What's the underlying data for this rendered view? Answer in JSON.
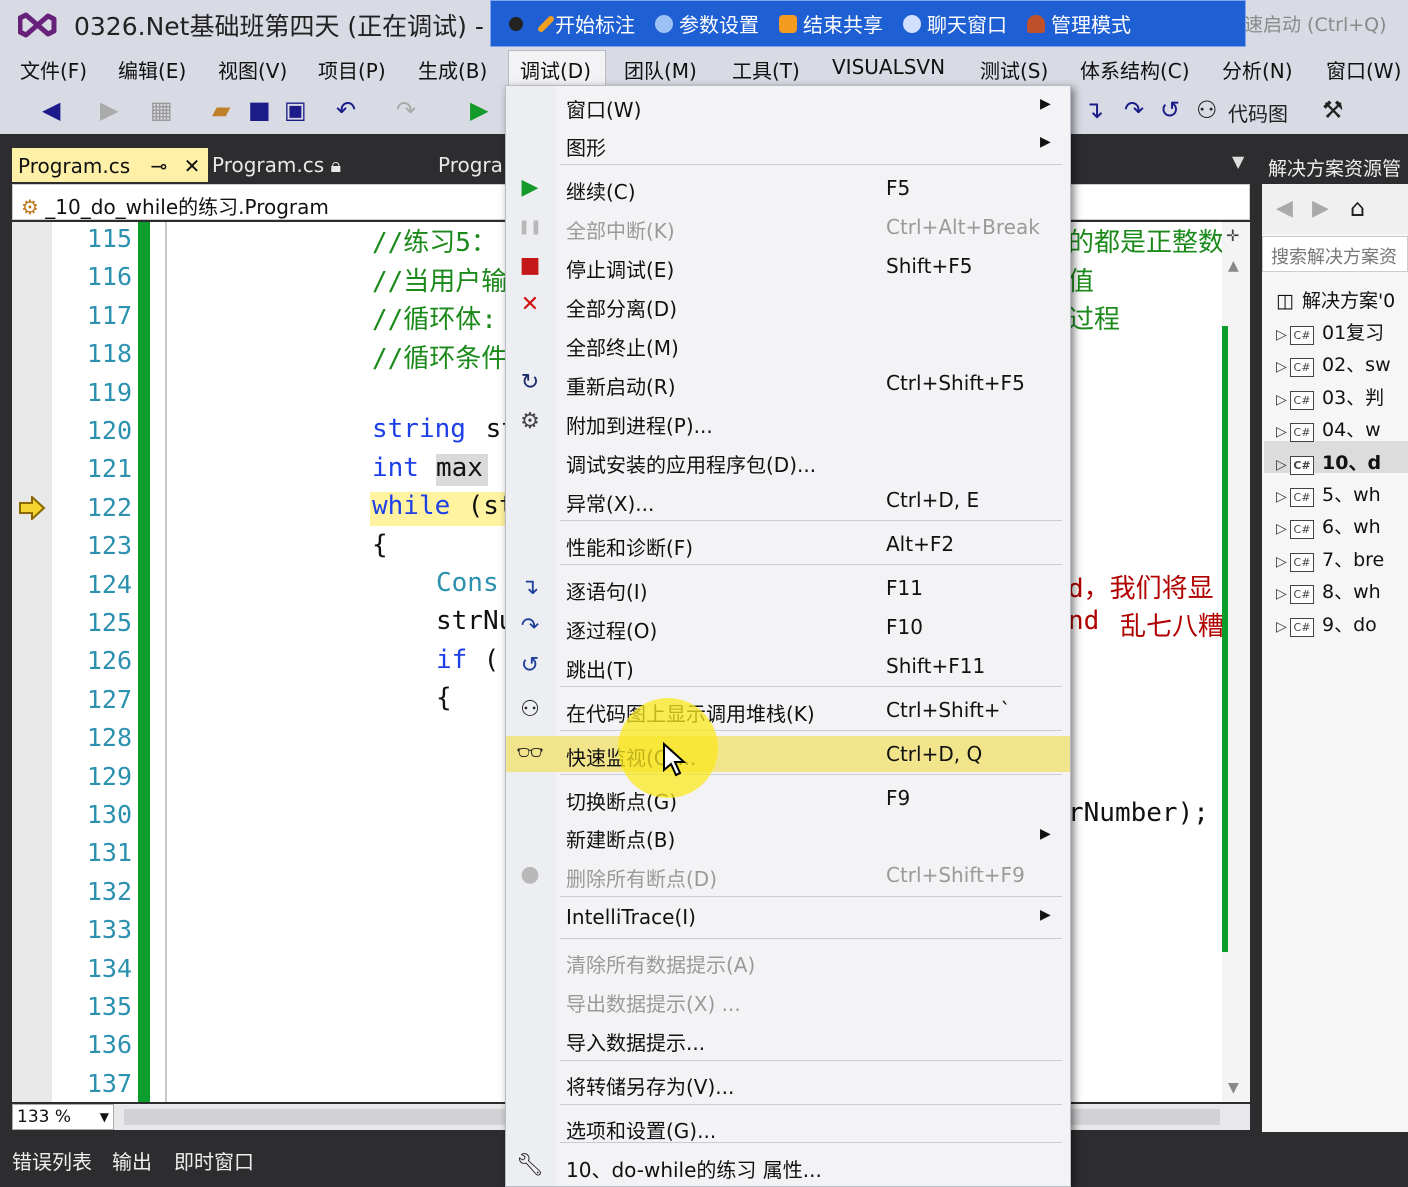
{
  "window": {
    "title": "0326.Net基础班第四天 (正在调试) -",
    "quick_launch_placeholder": "速启动 (Ctrl+Q)"
  },
  "capture_bar": {
    "items": [
      "开始标注",
      "参数设置",
      "结束共享",
      "聊天窗口",
      "管理模式"
    ]
  },
  "menubar": {
    "items": [
      "文件(F)",
      "编辑(E)",
      "视图(V)",
      "项目(P)",
      "生成(B)",
      "调试(D)",
      "团队(M)",
      "工具(T)",
      "VISUALSVN",
      "测试(S)",
      "体系结构(C)",
      "分析(N)",
      "窗口(W)"
    ]
  },
  "toolbar": {
    "codemap_label": "代码图"
  },
  "tabs": {
    "active": "Program.cs",
    "second": "Program.cs",
    "third": "Progra"
  },
  "navbar": {
    "path": "_10_do_while的练习.Program"
  },
  "editor": {
    "line_numbers": [
      "115",
      "116",
      "117",
      "118",
      "119",
      "120",
      "121",
      "122",
      "123",
      "124",
      "125",
      "126",
      "127",
      "128",
      "129",
      "130",
      "131",
      "132",
      "133",
      "134",
      "135",
      "136",
      "137"
    ],
    "code": {
      "l115": "//练习5：",
      "l115r": "的都是正整数",
      "l116": "//当用户输",
      "l116r": "值",
      "l117": "//循环体:",
      "l117r": "过程",
      "l118": "//循环条件",
      "l120_kw": "string",
      "l120_tx": " st",
      "l121_kw": "int",
      "l121_tx": "max",
      "l122_kw": "while",
      "l122_tx": " (st",
      "l123": "{",
      "l124": "Cons",
      "l124r": "d，我们将显",
      "l125": "strNu",
      "l125r_a": "nd",
      "l125r_b": "乱七八糟",
      "l126_kw": "if",
      "l126_tx": " (",
      "l127": "{",
      "l130r": "rNumber);"
    },
    "zoom": "133 %"
  },
  "bottom_tabs": [
    "错误列表",
    "输出",
    "即时窗口"
  ],
  "solution_explorer": {
    "header": "解决方案资源管",
    "search_placeholder": "搜索解决方案资",
    "root": "解决方案'0",
    "items": [
      "01复习",
      "02、sw",
      "03、判",
      "04、w",
      "10、d",
      "5、wh",
      "6、wh",
      "7、bre",
      "8、wh",
      "9、do"
    ],
    "selected_index": 4
  },
  "debug_menu": {
    "items": [
      {
        "label": "窗口(W)",
        "shortcut": "",
        "submenu": true,
        "disabled": false,
        "icon": ""
      },
      {
        "label": "图形",
        "shortcut": "",
        "submenu": true,
        "disabled": false,
        "icon": ""
      },
      {
        "label": "继续(C)",
        "shortcut": "F5",
        "submenu": false,
        "disabled": false,
        "icon": "play-icon"
      },
      {
        "label": "全部中断(K)",
        "shortcut": "Ctrl+Alt+Break",
        "submenu": false,
        "disabled": true,
        "icon": "pause-icon"
      },
      {
        "label": "停止调试(E)",
        "shortcut": "Shift+F5",
        "submenu": false,
        "disabled": false,
        "icon": "stop-icon"
      },
      {
        "label": "全部分离(D)",
        "shortcut": "",
        "submenu": false,
        "disabled": false,
        "icon": "detach-icon"
      },
      {
        "label": "全部终止(M)",
        "shortcut": "",
        "submenu": false,
        "disabled": false,
        "icon": ""
      },
      {
        "label": "重新启动(R)",
        "shortcut": "Ctrl+Shift+F5",
        "submenu": false,
        "disabled": false,
        "icon": "restart-icon"
      },
      {
        "label": "附加到进程(P)...",
        "shortcut": "",
        "submenu": false,
        "disabled": false,
        "icon": "attach-icon"
      },
      {
        "label": "调试安装的应用程序包(D)...",
        "shortcut": "",
        "submenu": false,
        "disabled": false,
        "icon": ""
      },
      {
        "label": "异常(X)...",
        "shortcut": "Ctrl+D, E",
        "submenu": false,
        "disabled": false,
        "icon": ""
      },
      {
        "label": "性能和诊断(F)",
        "shortcut": "Alt+F2",
        "submenu": false,
        "disabled": false,
        "icon": ""
      },
      {
        "label": "逐语句(I)",
        "shortcut": "F11",
        "submenu": false,
        "disabled": false,
        "icon": "step-into-icon"
      },
      {
        "label": "逐过程(O)",
        "shortcut": "F10",
        "submenu": false,
        "disabled": false,
        "icon": "step-over-icon"
      },
      {
        "label": "跳出(T)",
        "shortcut": "Shift+F11",
        "submenu": false,
        "disabled": false,
        "icon": "step-out-icon"
      },
      {
        "label": "在代码图上显示调用堆栈(K)",
        "shortcut": "Ctrl+Shift+`",
        "submenu": false,
        "disabled": false,
        "icon": "code-map-icon"
      },
      {
        "label": "快速监视(Q)...",
        "shortcut": "Ctrl+D, Q",
        "submenu": false,
        "disabled": false,
        "icon": "glasses-icon",
        "highlighted": true
      },
      {
        "label": "切换断点(G)",
        "shortcut": "F9",
        "submenu": false,
        "disabled": false,
        "icon": ""
      },
      {
        "label": "新建断点(B)",
        "shortcut": "",
        "submenu": true,
        "disabled": false,
        "icon": ""
      },
      {
        "label": "删除所有断点(D)",
        "shortcut": "Ctrl+Shift+F9",
        "submenu": false,
        "disabled": true,
        "icon": "delete-breakpoints-icon"
      },
      {
        "label": "IntelliTrace(I)",
        "shortcut": "",
        "submenu": true,
        "disabled": false,
        "icon": ""
      },
      {
        "label": "清除所有数据提示(A)",
        "shortcut": "",
        "submenu": false,
        "disabled": true,
        "icon": ""
      },
      {
        "label": "导出数据提示(X) ...",
        "shortcut": "",
        "submenu": false,
        "disabled": true,
        "icon": ""
      },
      {
        "label": "导入数据提示...",
        "shortcut": "",
        "submenu": false,
        "disabled": false,
        "icon": ""
      },
      {
        "label": "将转储另存为(V)...",
        "shortcut": "",
        "submenu": false,
        "disabled": false,
        "icon": ""
      },
      {
        "label": "选项和设置(G)...",
        "shortcut": "",
        "submenu": false,
        "disabled": false,
        "icon": ""
      },
      {
        "label": "10、do-while的练习 属性...",
        "shortcut": "",
        "submenu": false,
        "disabled": false,
        "icon": "wrench-icon"
      }
    ]
  }
}
